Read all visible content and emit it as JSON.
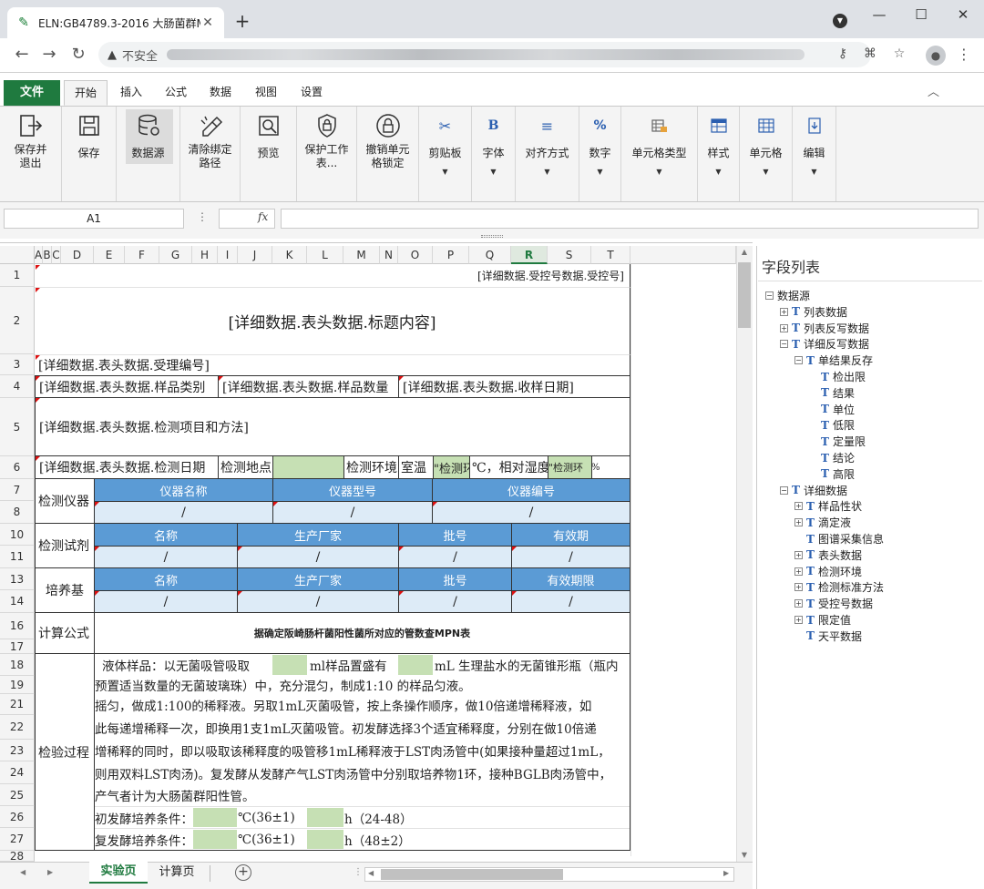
{
  "browser": {
    "tab_title": "ELN:GB4789.3-2016 大肠菌群M",
    "insecure_label": "不安全"
  },
  "ribbon": {
    "file_tab": "文件",
    "tabs": [
      "开始",
      "插入",
      "公式",
      "数据",
      "视图",
      "设置"
    ],
    "groups": [
      {
        "label": "保存并\n退出",
        "icon": "exit-icon"
      },
      {
        "label": "保存",
        "icon": "save-icon"
      },
      {
        "label": "数据源",
        "icon": "database-icon"
      },
      {
        "label": "清除绑定\n路径",
        "icon": "clear-binding-icon"
      },
      {
        "label": "预览",
        "icon": "preview-icon"
      },
      {
        "label": "保护工作\n表...",
        "icon": "shield-lock-icon"
      },
      {
        "label": "撤销单元\n格锁定",
        "icon": "unlock-icon"
      },
      {
        "label": "剪贴板",
        "icon": "scissors-icon"
      },
      {
        "label": "字体",
        "icon": "bold-icon"
      },
      {
        "label": "对齐方式",
        "icon": "align-icon"
      },
      {
        "label": "数字",
        "icon": "percent-icon"
      },
      {
        "label": "单元格类型",
        "icon": "cell-type-icon"
      },
      {
        "label": "样式",
        "icon": "style-icon"
      },
      {
        "label": "单元格",
        "icon": "cells-icon"
      },
      {
        "label": "编辑",
        "icon": "edit-icon"
      }
    ]
  },
  "formula_bar": {
    "name_box": "A1",
    "fx": "fx",
    "value": ""
  },
  "sheet": {
    "columns": [
      "A",
      "B",
      "C",
      "D",
      "E",
      "F",
      "G",
      "H",
      "I",
      "J",
      "K",
      "L",
      "M",
      "N",
      "O",
      "P",
      "Q",
      "R",
      "S",
      "T"
    ],
    "selected_column": "R",
    "rows": [
      "1",
      "2",
      "3",
      "4",
      "5",
      "6",
      "7",
      "8",
      "10",
      "11",
      "13",
      "14",
      "16",
      "17",
      "18",
      "19",
      "21",
      "22",
      "23",
      "24",
      "25",
      "26",
      "27",
      "28"
    ],
    "r1_receipt": "[详细数据.受控号数据.受控号]",
    "r2_title": "[详细数据.表头数据.标题内容]",
    "r3_accept": "[详细数据.表头数据.受理编号]",
    "r4_a": "[详细数据.表头数据.样品类别",
    "r4_b": "[详细数据.表头数据.样品数量",
    "r4_c": "[详细数据.表头数据.收样日期]",
    "r5_method": "[详细数据.表头数据.检测项目和方法]",
    "r6_date": "[详细数据.表头数据.检测日期",
    "r6_place": "检测地点",
    "r6_env": "检测环境",
    "r6_room": "室温",
    "r6_env_val": "\"检测环",
    "r6_celsius": "℃，相对湿度",
    "r6_env2": "\"检测环",
    "r6_pct": "%",
    "instr_label": "检测仪器",
    "instr_headers": [
      "仪器名称",
      "仪器型号",
      "仪器编号"
    ],
    "reagent_label": "检测试剂",
    "reagent_headers": [
      "名称",
      "生产厂家",
      "批号",
      "有效期"
    ],
    "medium_label": "培养基",
    "medium_headers": [
      "名称",
      "生产厂家",
      "批号",
      "有效期限"
    ],
    "slash": "/",
    "formula_label": "计算公式",
    "formula_text": "据确定阪崎肠杆菌阳性菌所对应的管数查MPN表",
    "process_label": "检验过程",
    "p18_a": "液体样品：以无菌吸管吸取",
    "p18_b": "ml样品置盛有",
    "p18_c": "mL 生理盐水的无菌锥形瓶（瓶内",
    "p19": "预置适当数量的无菌玻璃珠）中，充分混匀，制成1:10 的样品匀液。",
    "p21": "摇匀，做成1:100的稀释液。另取1mL灭菌吸管，按上条操作顺序，做10倍递增稀释液，如",
    "p22": "此每递增稀释一次，即换用1支1mL灭菌吸管。初发酵选择3个适宜稀释度，分别在做10倍递",
    "p23": "增稀释的同时，即以吸取该稀释度的吸管移1mL稀释液于LST肉汤管中(如果接种量超过1mL，",
    "p24": "则用双料LST肉汤)。复发酵从发酵产气LST肉汤管中分别取培养物1环，接种BGLB肉汤管中，",
    "p25": "产气者计为大肠菌群阳性管。",
    "p26_a": "初发酵培养条件：",
    "p26_b": "℃(36±1)",
    "p26_c": "h（24-48）",
    "p27_a": "复发酵培养条件：",
    "p27_b": "℃(36±1)",
    "p27_c": "h（48±2）"
  },
  "sheet_tabs": [
    "实验页",
    "计算页"
  ],
  "panel": {
    "title": "字段列表",
    "tree": [
      {
        "depth": 0,
        "toggle": "⊟",
        "icon": false,
        "label": "数据源"
      },
      {
        "depth": 1,
        "toggle": "⊞",
        "icon": true,
        "label": "列表数据"
      },
      {
        "depth": 1,
        "toggle": "⊞",
        "icon": true,
        "label": "列表反写数据"
      },
      {
        "depth": 1,
        "toggle": "⊟",
        "icon": true,
        "label": "详细反写数据"
      },
      {
        "depth": 2,
        "toggle": "⊟",
        "icon": true,
        "label": "单结果反存"
      },
      {
        "depth": 3,
        "toggle": "",
        "icon": true,
        "label": "检出限"
      },
      {
        "depth": 3,
        "toggle": "",
        "icon": true,
        "label": "结果"
      },
      {
        "depth": 3,
        "toggle": "",
        "icon": true,
        "label": "单位"
      },
      {
        "depth": 3,
        "toggle": "",
        "icon": true,
        "label": "低限"
      },
      {
        "depth": 3,
        "toggle": "",
        "icon": true,
        "label": "定量限"
      },
      {
        "depth": 3,
        "toggle": "",
        "icon": true,
        "label": "结论"
      },
      {
        "depth": 3,
        "toggle": "",
        "icon": true,
        "label": "高限"
      },
      {
        "depth": 1,
        "toggle": "⊟",
        "icon": true,
        "label": "详细数据"
      },
      {
        "depth": 2,
        "toggle": "⊞",
        "icon": true,
        "label": "样品性状"
      },
      {
        "depth": 2,
        "toggle": "⊞",
        "icon": true,
        "label": "滴定液"
      },
      {
        "depth": 2,
        "toggle": "",
        "icon": true,
        "label": "图谱采集信息"
      },
      {
        "depth": 2,
        "toggle": "⊞",
        "icon": true,
        "label": "表头数据"
      },
      {
        "depth": 2,
        "toggle": "⊞",
        "icon": true,
        "label": "检测环境"
      },
      {
        "depth": 2,
        "toggle": "⊞",
        "icon": true,
        "label": "检测标准方法"
      },
      {
        "depth": 2,
        "toggle": "⊞",
        "icon": true,
        "label": "受控号数据"
      },
      {
        "depth": 2,
        "toggle": "⊞",
        "icon": true,
        "label": "限定值"
      },
      {
        "depth": 2,
        "toggle": "",
        "icon": true,
        "label": "天平数据"
      }
    ]
  }
}
